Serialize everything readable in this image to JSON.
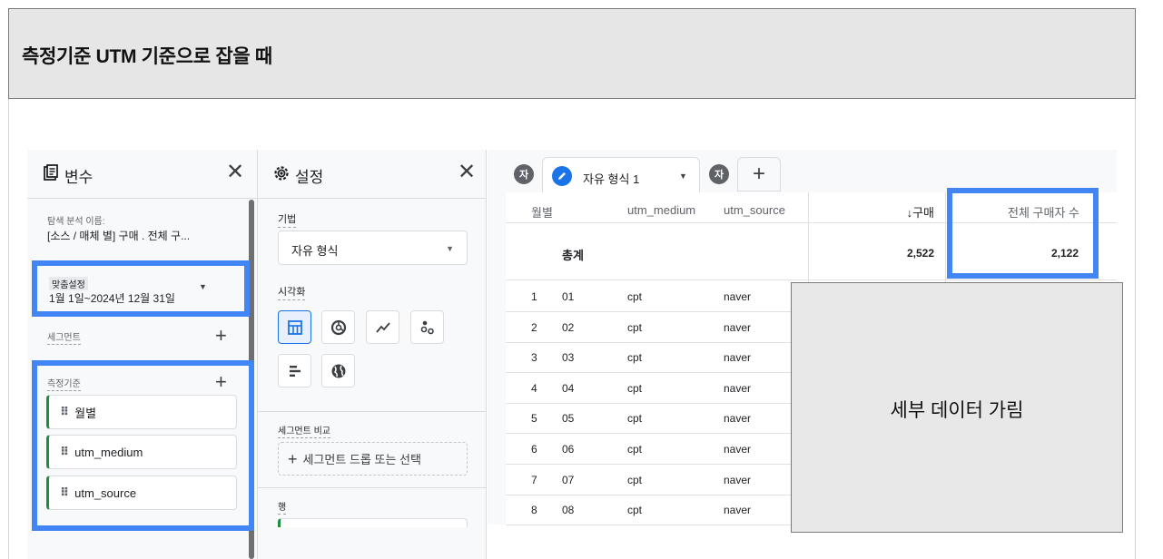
{
  "title": "측정기준 UTM 기준으로 잡을 때",
  "variables": {
    "header": "변수",
    "explore_name_label": "탐색 분석 이름:",
    "explore_name": "[소스 / 매체 별] 구매 . 전체 구...",
    "date_tag": "맞춤설정",
    "date_range": "1월 1일~2024년 12월 31일",
    "segments_label": "세그먼트",
    "dimensions_label": "측정기준",
    "dimensions": [
      "월별",
      "utm_medium",
      "utm_source"
    ]
  },
  "settings": {
    "header": "설정",
    "technique_label": "기법",
    "technique_value": "자유 형식",
    "visualization_label": "시각화",
    "viz_icons": [
      "table-icon",
      "donut-chart-icon",
      "line-chart-icon",
      "scatter-icon",
      "bar-chart-icon",
      "globe-icon"
    ],
    "segment_compare_label": "세그먼트 비교",
    "segment_drop": "세그먼트 드롭 또는 선택",
    "rows_label": "행"
  },
  "report": {
    "tab_avatar": "자",
    "tab_name": "자유 형식 1",
    "columns": [
      "월별",
      "utm_medium",
      "utm_source",
      "↓구매",
      "전체 구매자 수"
    ],
    "total_label": "총계",
    "total_purchases": "2,522",
    "total_buyers": "2,122",
    "rows": [
      [
        "1",
        "01",
        "cpt",
        "naver"
      ],
      [
        "2",
        "02",
        "cpt",
        "naver"
      ],
      [
        "3",
        "03",
        "cpt",
        "naver"
      ],
      [
        "4",
        "04",
        "cpt",
        "naver"
      ],
      [
        "5",
        "05",
        "cpt",
        "naver"
      ],
      [
        "6",
        "06",
        "cpt",
        "naver"
      ],
      [
        "7",
        "07",
        "cpt",
        "naver"
      ],
      [
        "8",
        "08",
        "cpt",
        "naver"
      ]
    ]
  },
  "hidden_overlay": "세부 데이터 가림",
  "colors": {
    "highlight": "#4285f4",
    "accent": "#1a73e8",
    "chip_bar": "#1e8e3e"
  }
}
